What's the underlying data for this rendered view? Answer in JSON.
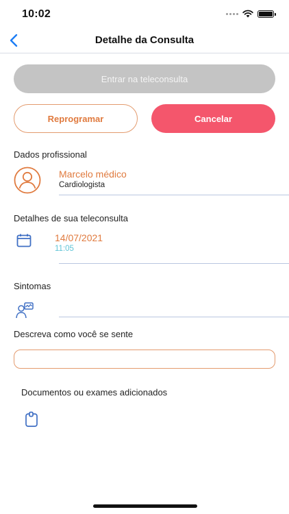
{
  "status_bar": {
    "time": "10:02",
    "icons": [
      "cellular-dots-icon",
      "wifi-icon",
      "battery-icon"
    ]
  },
  "nav": {
    "title": "Detalhe da Consulta",
    "back_icon": "chevron-left-icon"
  },
  "actions": {
    "enter_label": "Entrar na teleconsulta",
    "reschedule_label": "Reprogramar",
    "cancel_label": "Cancelar"
  },
  "professional": {
    "section_label": "Dados profissional",
    "name": "Marcelo médico",
    "specialty": "Cardiologista",
    "icon": "user-avatar-icon"
  },
  "details": {
    "section_label": "Detalhes de sua teleconsulta",
    "date": "14/07/2021",
    "time": "11:05",
    "icon": "calendar-icon"
  },
  "symptoms": {
    "section_label": "Sintomas",
    "icon": "symptoms-icon"
  },
  "feeling": {
    "section_label": "Descreva como você se sente",
    "value": "",
    "placeholder": ""
  },
  "documents": {
    "section_label": "Documentos ou exames adicionados",
    "icon": "clipboard-icon"
  },
  "colors": {
    "accent_orange": "#e07a3e",
    "cancel_red": "#f4566c",
    "disabled_gray": "#c4c4c4",
    "link_blue": "#1a7cf5",
    "time_cyan": "#5fc4d6"
  }
}
